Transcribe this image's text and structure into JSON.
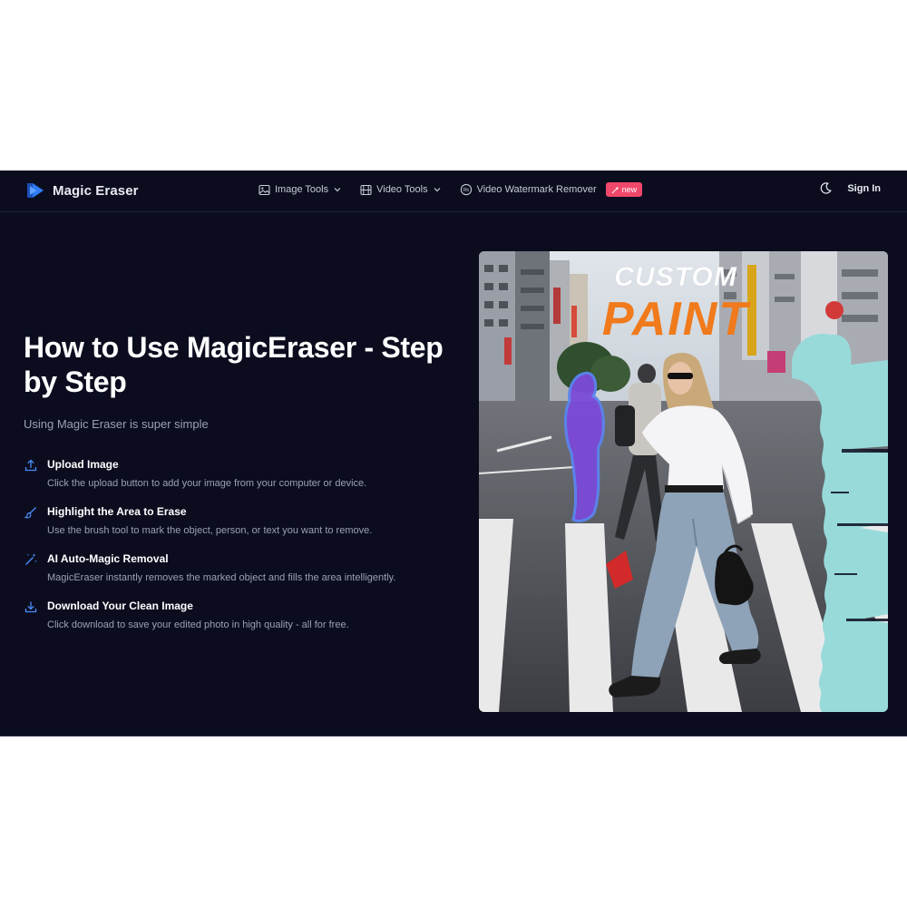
{
  "brand": {
    "name": "Magic Eraser",
    "color": "#2f7cf6"
  },
  "nav": {
    "image_tools": "Image Tools",
    "video_tools": "Video Tools",
    "watermark": "Video Watermark Remover",
    "new_badge": "new",
    "sign_in": "Sign In",
    "theme_icon": "moon-icon"
  },
  "hero": {
    "title": "How to Use MagicEraser - Step by Step",
    "subtitle": "Using Magic Eraser is super simple"
  },
  "steps": [
    {
      "icon": "upload-icon",
      "title": "Upload Image",
      "desc": "Click the upload button to add your image from your computer or device."
    },
    {
      "icon": "brush-icon",
      "title": "Highlight the Area to Erase",
      "desc": "Use the brush tool to mark the object, person, or text you want to remove."
    },
    {
      "icon": "magic-wand-icon",
      "title": "AI Auto-Magic Removal",
      "desc": "MagicEraser instantly removes the marked object and fills the area intelligently."
    },
    {
      "icon": "download-icon",
      "title": "Download Your Clean Image",
      "desc": "Click download to save your edited photo in high quality - all for free."
    }
  ],
  "demo_image": {
    "sign_top": "CUSTOM",
    "sign_bottom": "PAINT",
    "mask_purple": "#7b4ad8",
    "mask_cyan": "#98dada"
  },
  "colors": {
    "background": "#0b0d1f",
    "accent": "#2f7cf6",
    "badge": "#f0486a"
  }
}
